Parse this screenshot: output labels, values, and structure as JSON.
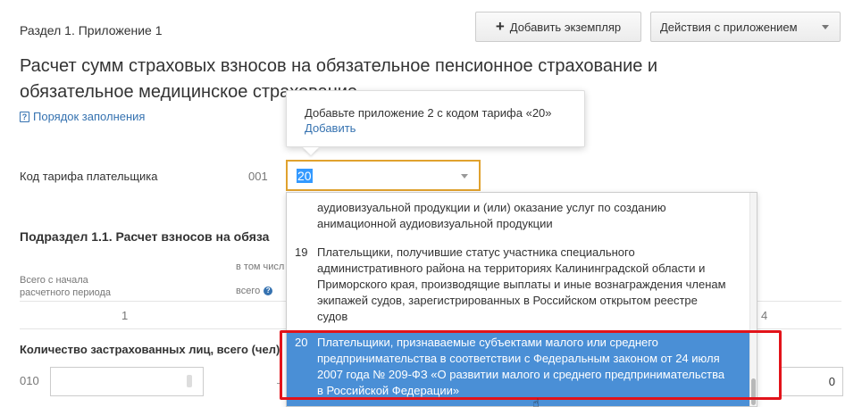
{
  "header": {
    "section_label": "Раздел 1. Приложение 1",
    "title": "Расчет сумм страховых взносов на обязательное пенсионное страхование и обязательное медицинское страхование",
    "help_link": "Порядок заполнения",
    "add_button": "Добавить экземпляр",
    "actions_button": "Действия с приложением"
  },
  "tariff": {
    "label": "Код тарифа плательщика",
    "code": "001",
    "selected_value": "20"
  },
  "tooltip": {
    "message": "Добавьте приложение 2 с кодом тарифа «20»",
    "link": "Добавить"
  },
  "dropdown": {
    "items": [
      {
        "code": "",
        "text": "аудиовизуальной продукции и (или) оказание услуг по созданию анимационной аудиовизуальной продукции",
        "selected": false
      },
      {
        "code": "19",
        "text": "Плательщики, получившие статус участника специального административного района на территориях Калининградской области и Приморского края, производящие выплаты и иные вознаграждения членам экипажей судов, зарегистрированных в Российском открытом реестре судов",
        "selected": false
      },
      {
        "code": "20",
        "text": "Плательщики, признаваемые субъектами малого или среднего предпринимательства в соответствии с Федеральным законом от 24 июля 2007 года № 209-ФЗ «О развитии малого и среднего предпринимательства в Российской Федерации»",
        "selected": true
      }
    ]
  },
  "subsection": {
    "title": "Подраздел 1.1. Расчет взносов на обяза",
    "col_total": "Всего с начала расчетного периода",
    "col_including": "в том числ",
    "col_total_short": "всего",
    "col_num_1": "1",
    "col_num_4": "4",
    "row_label": "Количество застрахованных лиц, всего (чел)",
    "row_code": "010",
    "row_value": "0"
  },
  "colors": {
    "accent_link": "#3572b0",
    "selected_row": "#4a8fd6",
    "focus_border": "#e0a22e",
    "annotation_red": "#e2131a"
  }
}
